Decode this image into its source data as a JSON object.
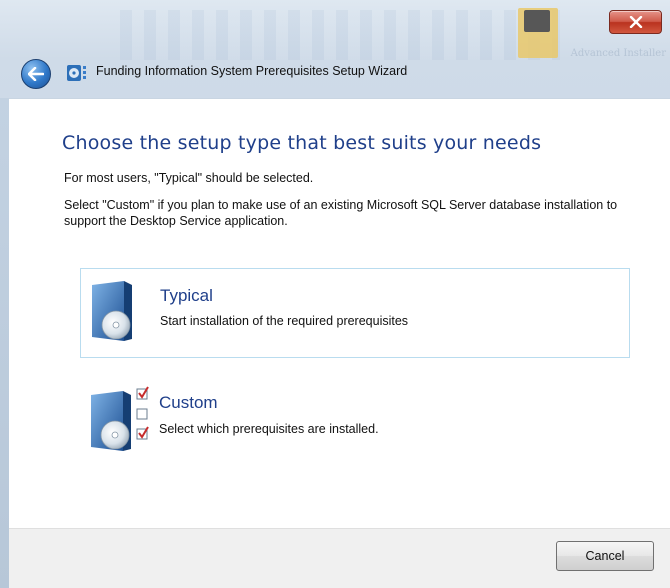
{
  "window": {
    "title": "Funding Information System Prerequisites Setup Wizard",
    "brand_watermark": "Advanced Installer",
    "close_label": "x"
  },
  "header": {
    "heading": "Choose the setup type that best suits your needs",
    "line1": "For most users, \"Typical\" should be selected.",
    "line2": "Select \"Custom\" if you plan to make use of an existing Microsoft SQL Server database installation to support the Desktop Service application."
  },
  "options": [
    {
      "title": "Typical",
      "description": "Start installation of the required prerequisites",
      "icon": "cd-box-icon"
    },
    {
      "title": "Custom",
      "description": "Select which prerequisites are installed.",
      "icon": "cd-box-checklist-icon"
    }
  ],
  "footer": {
    "cancel_label": "Cancel"
  },
  "colors": {
    "accent": "#1f3f8a",
    "selection_border": "#b9dcef",
    "close": "#c8432f"
  }
}
